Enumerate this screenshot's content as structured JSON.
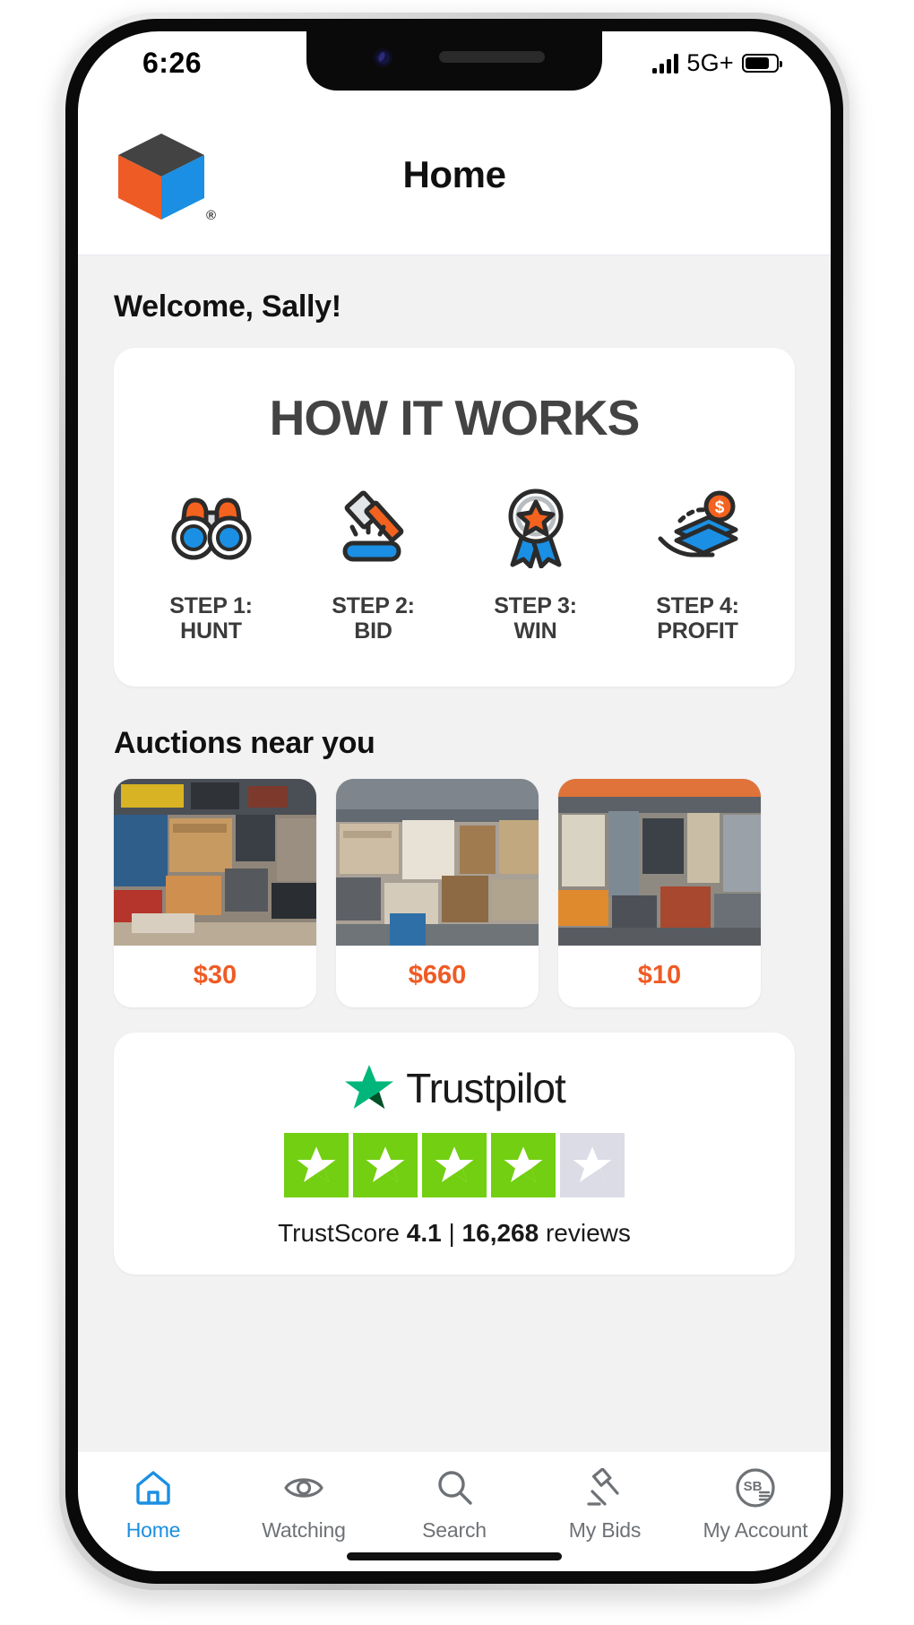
{
  "status_bar": {
    "time": "6:26",
    "network": "5G+",
    "signal_icon": "cellular-bars-icon",
    "battery_icon": "battery-icon"
  },
  "header": {
    "title": "Home",
    "logo_icon": "cube-logo-icon",
    "logo_registered_mark": "®"
  },
  "welcome": {
    "greeting": "Welcome, Sally!"
  },
  "how_it_works": {
    "title": "HOW IT WORKS",
    "steps": [
      {
        "label": "STEP 1:\nHUNT",
        "icon": "binoculars-icon"
      },
      {
        "label": "STEP 2:\nBID",
        "icon": "gavel-icon"
      },
      {
        "label": "STEP 3:\nWIN",
        "icon": "award-ribbon-icon"
      },
      {
        "label": "STEP 4:\nPROFIT",
        "icon": "money-in-hand-icon"
      }
    ]
  },
  "auctions": {
    "section_title": "Auctions near you",
    "items": [
      {
        "price": "$30",
        "thumb_alt": "storage-unit-photo"
      },
      {
        "price": "$660",
        "thumb_alt": "storage-unit-photo"
      },
      {
        "price": "$10",
        "thumb_alt": "storage-unit-photo"
      }
    ]
  },
  "trustpilot": {
    "brand": "Trustpilot",
    "star_icon": "trustpilot-star-icon",
    "stars_filled": 4,
    "stars_total": 5,
    "score_prefix": "TrustScore ",
    "score_value": "4.1",
    "separator": " | ",
    "reviews_count": "16,268",
    "reviews_suffix": " reviews"
  },
  "tabbar": {
    "items": [
      {
        "label": "Home",
        "icon": "home-icon",
        "active": true
      },
      {
        "label": "Watching",
        "icon": "eye-icon",
        "active": false
      },
      {
        "label": "Search",
        "icon": "search-icon",
        "active": false
      },
      {
        "label": "My Bids",
        "icon": "gavel-icon",
        "active": false
      },
      {
        "label": "My Account",
        "icon": "account-avatar-icon",
        "active": false
      }
    ]
  },
  "colors": {
    "brand_orange": "#ef5b25",
    "brand_blue": "#1a8fe3",
    "brand_dark": "#434343",
    "trustpilot_green": "#73cf11",
    "background": "#f2f2f2"
  }
}
